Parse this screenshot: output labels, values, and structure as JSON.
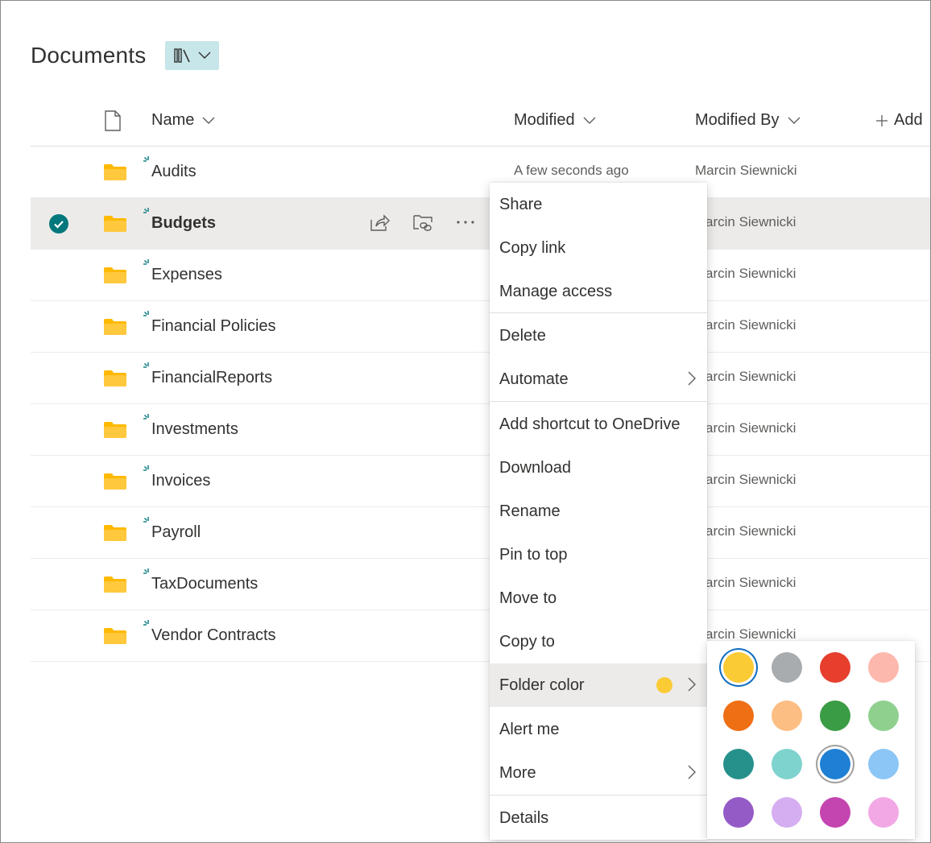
{
  "header": {
    "title": "Documents"
  },
  "columns": {
    "name": "Name",
    "modified": "Modified",
    "modified_by": "Modified By",
    "add": "Add"
  },
  "rows": [
    {
      "name": "Audits",
      "modified": "A few seconds ago",
      "modified_by": "Marcin Siewnicki"
    },
    {
      "name": "Budgets",
      "modified_by": "arcin Siewnicki"
    },
    {
      "name": "Expenses",
      "modified_by": "arcin Siewnicki"
    },
    {
      "name": "Financial Policies",
      "modified_by": "arcin Siewnicki"
    },
    {
      "name": "FinancialReports",
      "modified_by": "arcin Siewnicki"
    },
    {
      "name": "Investments",
      "modified_by": "arcin Siewnicki"
    },
    {
      "name": "Invoices",
      "modified_by": "arcin Siewnicki"
    },
    {
      "name": "Payroll",
      "modified_by": "arcin Siewnicki"
    },
    {
      "name": "TaxDocuments",
      "modified_by": "arcin Siewnicki"
    },
    {
      "name": "Vendor Contracts",
      "modified_by": "arcin Siewnicki"
    }
  ],
  "context_menu": {
    "items": [
      "Share",
      "Copy link",
      "Manage access",
      "Delete",
      "Automate",
      "Add shortcut to OneDrive",
      "Download",
      "Rename",
      "Pin to top",
      "Move to",
      "Copy to",
      "Folder color",
      "Alert me",
      "More",
      "Details"
    ],
    "current_folder_color": "#fbcb36"
  },
  "palette": {
    "colors": [
      "#fbcb36",
      "#a9acaf",
      "#e63f2e",
      "#fdb8ae",
      "#ef6f14",
      "#fdbe84",
      "#3a9c45",
      "#8fd08e",
      "#26918b",
      "#7fd3ce",
      "#1e7fd4",
      "#8bc6f6",
      "#945bc7",
      "#d5aef2",
      "#c444b0",
      "#f3a8e6"
    ],
    "selected_index": 0,
    "focused_index": 10
  },
  "colors": {
    "accent": "#03787c",
    "folder": "#ffb900"
  }
}
